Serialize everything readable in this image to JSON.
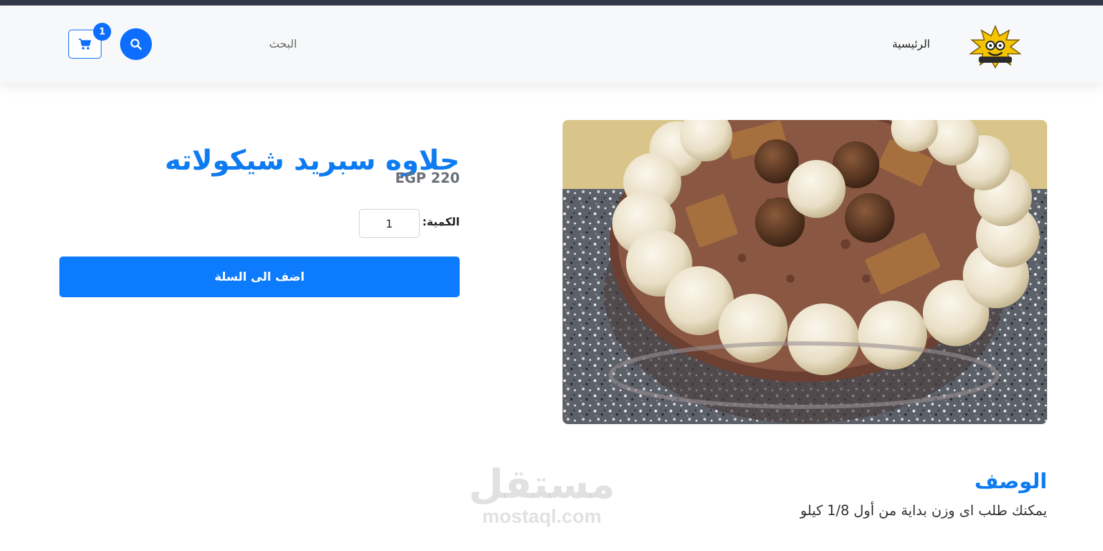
{
  "navbar": {
    "home_label": "الرئيسية",
    "search_label": "البحث",
    "cart_count": "1"
  },
  "product": {
    "title": "حلاوه سبريد شيكولاته",
    "price": "EGP 220",
    "quantity_label": "الكمية:",
    "quantity_value": "1",
    "add_to_cart_label": "اضف الى السلة",
    "description_title": "الوصف",
    "description_text": "يمكنك طلب اى وزن بداية من أول 1/8 كيلو"
  },
  "watermark": {
    "arabic": "مستقل",
    "latin": "mostaql.com"
  },
  "colors": {
    "accent": "#0d6efd",
    "title": "#0d7bf2",
    "topstrip": "#343a4a"
  }
}
